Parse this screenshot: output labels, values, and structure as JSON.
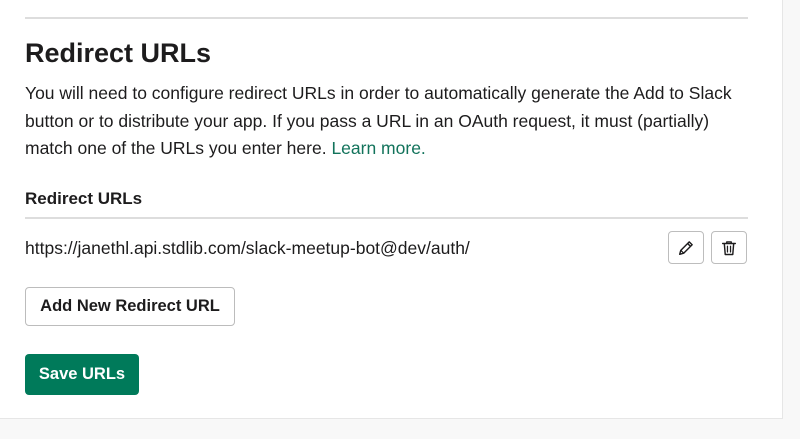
{
  "section": {
    "title": "Redirect URLs",
    "description": "You will need to configure redirect URLs in order to automatically generate the Add to Slack button or to distribute your app. If you pass a URL in an OAuth request, it must (partially) match one of the URLs you enter here.",
    "learn_more_label": "Learn more."
  },
  "redirect_list": {
    "header": "Redirect URLs",
    "urls": [
      {
        "url": "https://janethl.api.stdlib.com/slack-meetup-bot@dev/auth/",
        "edit_icon": "pencil-icon",
        "delete_icon": "trash-icon"
      }
    ]
  },
  "actions": {
    "add_label": "Add New Redirect URL",
    "save_label": "Save URLs"
  },
  "colors": {
    "primary": "#007a5a",
    "link": "#12735b",
    "text": "#1d1c1d",
    "border": "#dddddd"
  }
}
